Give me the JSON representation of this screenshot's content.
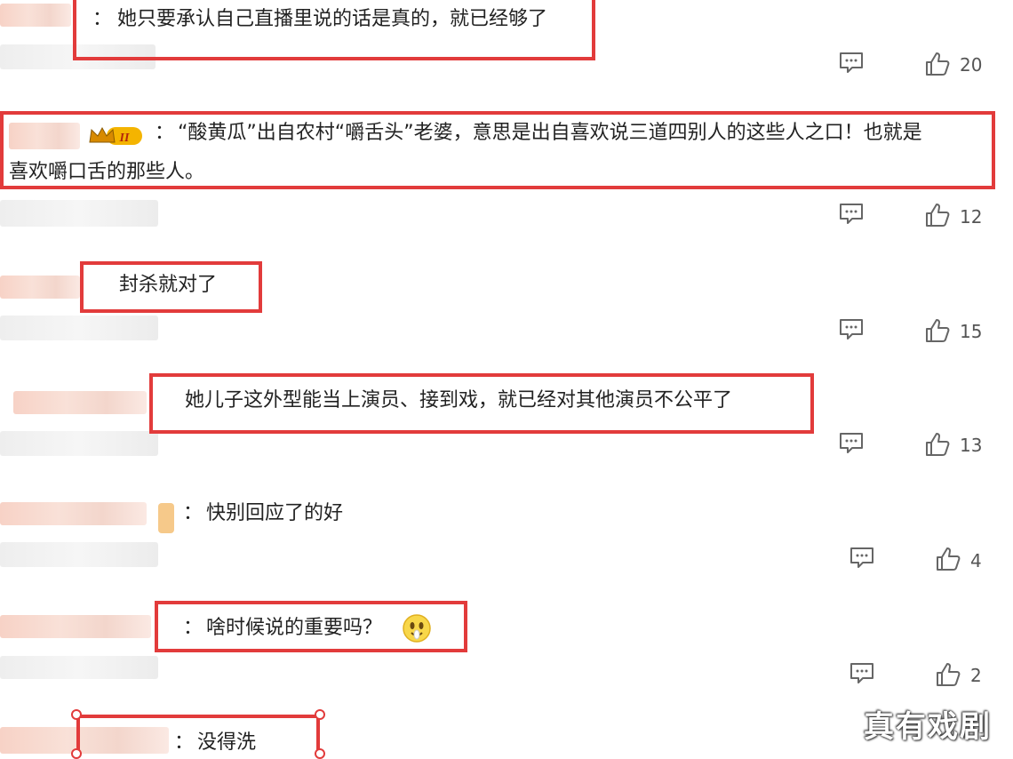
{
  "comments": [
    {
      "prefix": "：",
      "text": "她只要承认自己直播里说的话是真的，就已经够了",
      "likes": "20"
    },
    {
      "prefix": "：",
      "line1": "“酸黄瓜”出自农村“嚼舌头”老婆，意思是出自喜欢说三道四别人的这些人之口！也就是",
      "line2": "喜欢嚼口舌的那些人。",
      "likes": "12",
      "badge_level": "II"
    },
    {
      "prefix": "",
      "text": "封杀就对了",
      "likes": "15"
    },
    {
      "prefix": "",
      "text": "她儿子这外型能当上演员、接到戏，就已经对其他演员不公平了",
      "likes": "13"
    },
    {
      "prefix": "：",
      "text": "快别回应了的好",
      "likes": "4"
    },
    {
      "prefix": "：",
      "text": "啥时候说的重要吗？",
      "likes": "2"
    },
    {
      "prefix": "：",
      "text": "没得洗"
    }
  ],
  "watermark": "真有戏剧",
  "colors": {
    "highlight": "#e23b3b",
    "icon": "#666666"
  },
  "icons": [
    "reply-icon",
    "thumbs-up-icon",
    "crown-icon",
    "emoji-icon"
  ]
}
